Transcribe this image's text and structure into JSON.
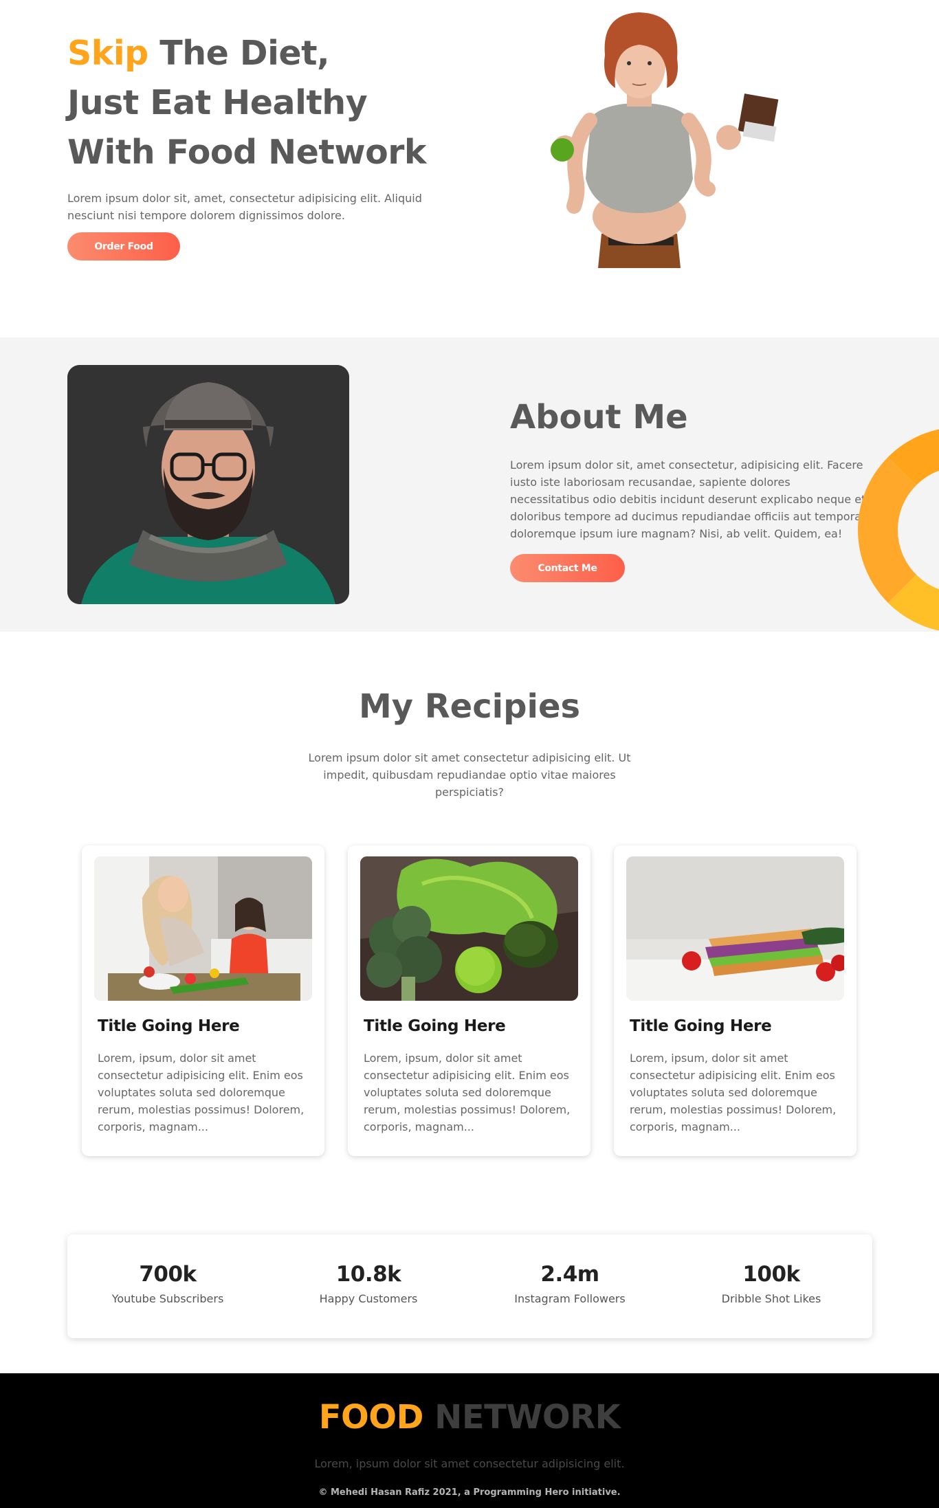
{
  "hero": {
    "title_accent": "Skip",
    "title_line1_rest": " The Diet,",
    "title_line2": "Just Eat Healthy",
    "title_line3": "With Food Network",
    "text": "Lorem ipsum dolor sit, amet, consectetur adipisicing elit. Aliquid nesciunt nisi tempore dolorem dignissimos dolore.",
    "button": "Order Food"
  },
  "about": {
    "title": "About Me",
    "text": "Lorem ipsum dolor sit, amet consectetur, adipisicing elit. Facere iusto iste laboriosam recusandae, sapiente dolores necessitatibus odio debitis incidunt deserunt explicabo neque et doloribus tempore ad ducimus repudiandae officiis aut tempora, doloremque ipsum iure magnam? Nisi, ab velit. Quidem, ea!",
    "button": "Contact Me"
  },
  "recipes": {
    "title": "My Recipies",
    "text": "Lorem ipsum dolor sit amet consectetur adipisicing elit. Ut impedit, quibusdam repudiandae optio vitae maiores perspiciatis?",
    "cards": [
      {
        "title": "Title Going Here",
        "text": "Lorem, ipsum, dolor sit amet consectetur adipisicing elit. Enim eos voluptates soluta sed doloremque rerum, molestias possimus! Dolorem, corporis, magnam..."
      },
      {
        "title": "Title Going Here",
        "text": "Lorem, ipsum, dolor sit amet consectetur adipisicing elit. Enim eos voluptates soluta sed doloremque rerum, molestias possimus! Dolorem, corporis, magnam..."
      },
      {
        "title": "Title Going Here",
        "text": "Lorem, ipsum, dolor sit amet consectetur adipisicing elit. Enim eos voluptates soluta sed doloremque rerum, molestias possimus! Dolorem, corporis, magnam..."
      }
    ]
  },
  "stats": [
    {
      "value": "700k",
      "label": "Youtube Subscribers"
    },
    {
      "value": "10.8k",
      "label": "Happy Customers"
    },
    {
      "value": "2.4m",
      "label": "Instagram Followers"
    },
    {
      "value": "100k",
      "label": "Dribble Shot Likes"
    }
  ],
  "footer": {
    "logo_food": "FOOD",
    "logo_network": "NETWORK",
    "text": "Lorem, ipsum dolor sit amet consectetur adipisicing elit.",
    "copyright": "© Mehedi Hasan Rafiz 2021, a Programming Hero initiative."
  },
  "colors": {
    "accent": "#ffa41b",
    "button_gradient_start": "#fb8c6f",
    "button_gradient_end": "#fd5f49",
    "heading": "#595959",
    "about_bg": "#f4f4f4",
    "footer_bg": "#000000"
  }
}
